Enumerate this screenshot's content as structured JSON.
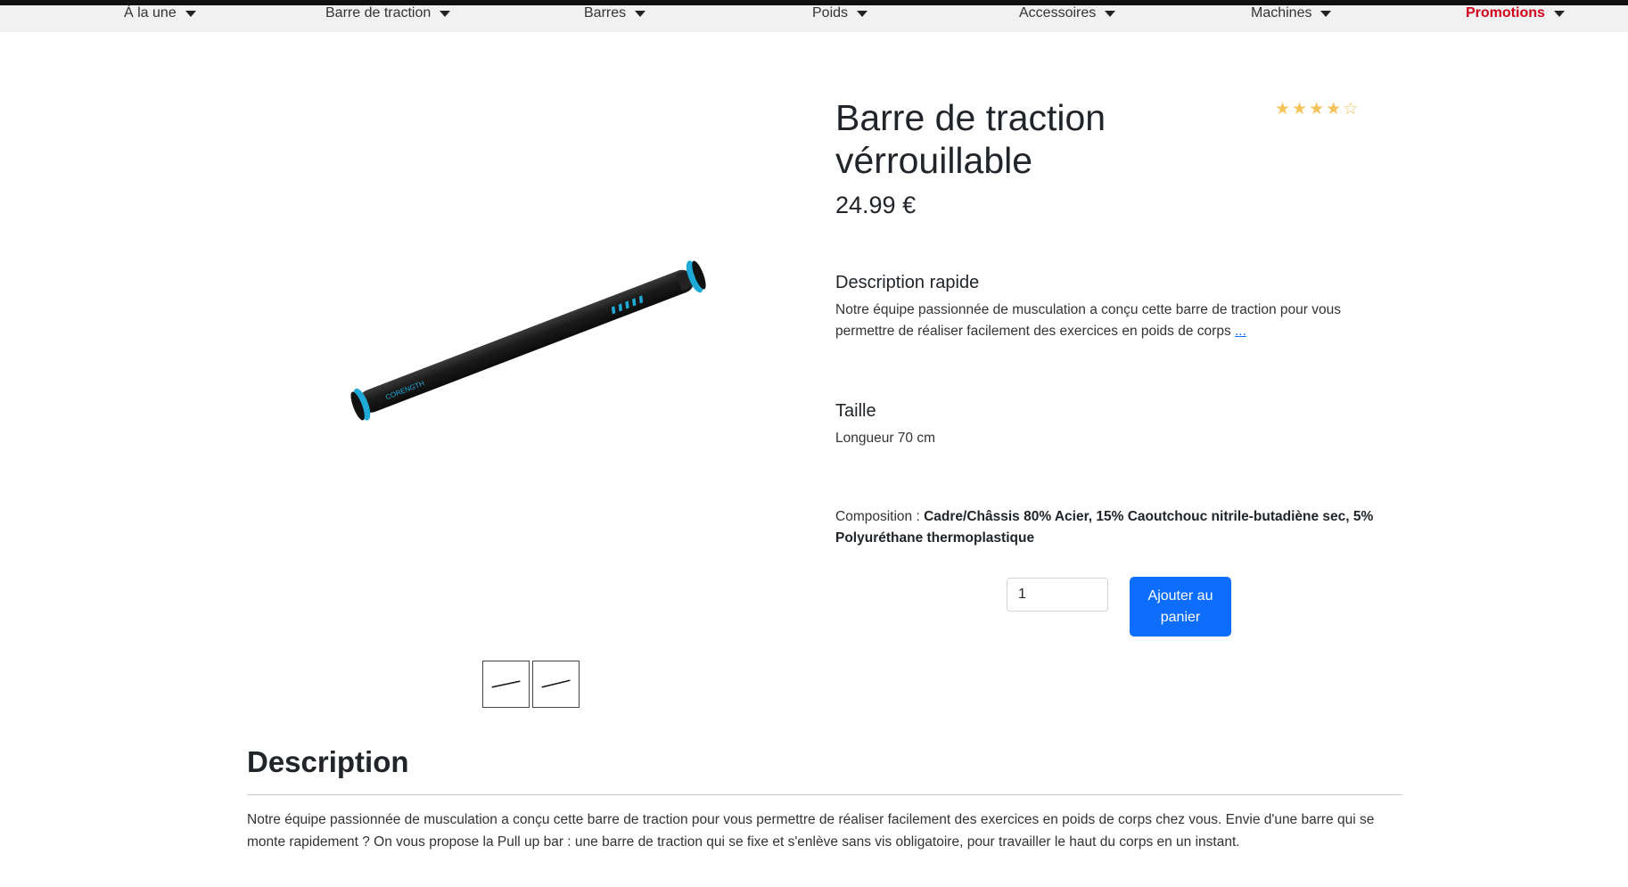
{
  "nav": {
    "items": [
      {
        "label": "À la une"
      },
      {
        "label": "Barre de traction"
      },
      {
        "label": "Barres"
      },
      {
        "label": "Poids"
      },
      {
        "label": "Accessoires"
      },
      {
        "label": "Machines"
      },
      {
        "label": "Promotions"
      }
    ]
  },
  "product": {
    "title": "Barre de traction vérrouillable",
    "price": "24.99 €",
    "rating": {
      "value": 4,
      "max": 5
    },
    "image_brand_text": "CORENGTH",
    "quick_description": {
      "heading": "Description rapide",
      "text": "Notre équipe passionnée de musculation a conçu cette barre de traction pour vous permettre de réaliser facilement des exercices en poids de corps",
      "more_link": "..."
    },
    "size": {
      "heading": "Taille",
      "text": "Longueur 70 cm"
    },
    "composition": {
      "label": "Composition : ",
      "value": "Cadre/Châssis 80% Acier, 15% Caoutchouc nitrile-butadiène sec, 5% Polyuréthane thermoplastique"
    },
    "quantity": "1",
    "add_to_cart_label": "Ajouter au panier"
  },
  "description": {
    "heading": "Description",
    "text": "Notre équipe passionnée de musculation a conçu cette barre de traction pour vous permettre de réaliser facilement des exercices en poids de corps chez vous. Envie d'une barre qui se monte rapidement ? On vous propose la Pull up bar : une barre de traction qui se fixe et s'enlève sans vis obligatoire, pour travailler le haut du corps en un instant."
  },
  "colors": {
    "accent": "#0d6efd",
    "promo": "#d0021b",
    "star": "#f5c35a",
    "bar_accent": "#1fa9d6"
  }
}
